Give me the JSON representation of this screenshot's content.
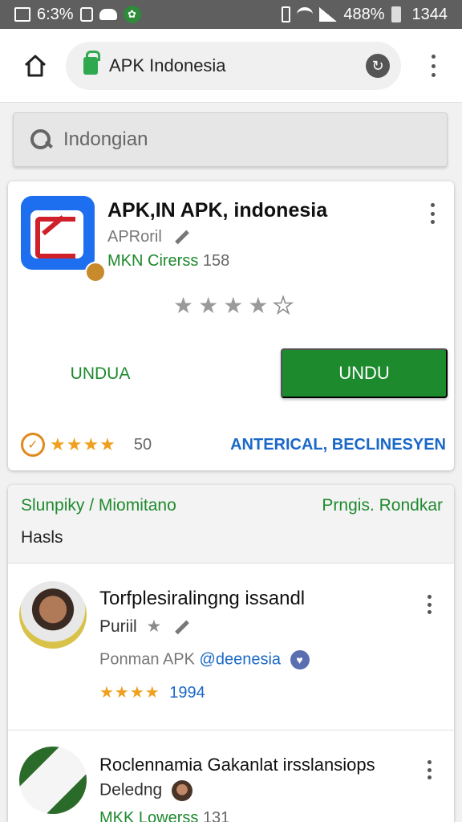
{
  "status_bar": {
    "left_text": "6:3%",
    "battery_percent": "488%",
    "time": "1344"
  },
  "browser": {
    "url": "APK Indonesia"
  },
  "search": {
    "value": "Indongian"
  },
  "app_card": {
    "title": "APK,IN APK, indonesia",
    "developer": "APRoril",
    "category": "MKN Cirerss",
    "category_count": "158",
    "rating_stars": 4,
    "secondary_button": "UNDUA",
    "primary_button": "UNDU",
    "meta_rating_stars": 3.5,
    "meta_count": "50",
    "meta_link": "ANTERICAL, BECLINESYEN"
  },
  "list_section": {
    "header_left": "Slunpiky / Miomitano",
    "header_right": "Prngis. Rondkar",
    "header_sub": "Hasls",
    "items": [
      {
        "title": "Torfplesiralingng issandl",
        "subtitle": "Puriil",
        "developer": "Ponman APK",
        "handle": "@deenesia",
        "stars": 4,
        "rating": "1994"
      },
      {
        "title": "Roclennamia Gakanlat irsslansiops",
        "subtitle": "Deledng",
        "category": "MKK Lowerss",
        "category_count": "131"
      }
    ]
  },
  "colors": {
    "accent_green": "#1e8a2e",
    "link_blue": "#1a68c8",
    "star_orange": "#f0a020"
  }
}
